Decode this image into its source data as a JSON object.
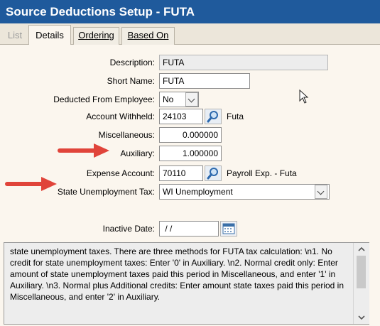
{
  "window": {
    "title": "Source Deductions Setup - FUTA"
  },
  "tabs": [
    {
      "label": "List",
      "state": "disabled"
    },
    {
      "label": "Details",
      "state": "active"
    },
    {
      "label": "Ordering",
      "state": "normal"
    },
    {
      "label": "Based On",
      "state": "normal"
    }
  ],
  "form": {
    "description": {
      "label": "Description:",
      "value": "FUTA"
    },
    "short_name": {
      "label": "Short Name:",
      "value": "FUTA"
    },
    "deducted_from_employee": {
      "label": "Deducted From Employee:",
      "value": "No"
    },
    "account_withheld": {
      "label": "Account Withheld:",
      "value": "24103",
      "account_name": "Futa"
    },
    "miscellaneous": {
      "label": "Miscellaneous:",
      "value": "0.000000"
    },
    "auxiliary": {
      "label": "Auxiliary:",
      "value": "1.000000"
    },
    "expense_account": {
      "label": "Expense Account:",
      "value": "70110",
      "account_name": "Payroll Exp. - Futa"
    },
    "state_unemployment_tax": {
      "label": "State Unemployment Tax:",
      "value": "WI Unemployment"
    },
    "inactive_date": {
      "label": "Inactive Date:",
      "value": " / /"
    }
  },
  "help_text": "state unemployment taxes.  There are three methods for FUTA tax calculation: \\n1. No credit for state unemployment taxes: Enter '0' in Auxiliary. \\n2. Normal credit only: Enter amount of state unemployment taxes paid this period in Miscellaneous, and enter '1' in Auxiliary. \\n3. Normal plus Additional credits: Enter amount state taxes paid this period in Miscellaneous, and enter '2' in Auxiliary.",
  "colors": {
    "title_bar": "#1f5a9c",
    "panel_bg": "#fbf6ee",
    "annotation_arrow": "#e0443a"
  },
  "icons": [
    "lookup-magnifier-icon",
    "chevron-down-icon",
    "calendar-icon",
    "red-arrow-annotation",
    "mouse-cursor-icon"
  ]
}
